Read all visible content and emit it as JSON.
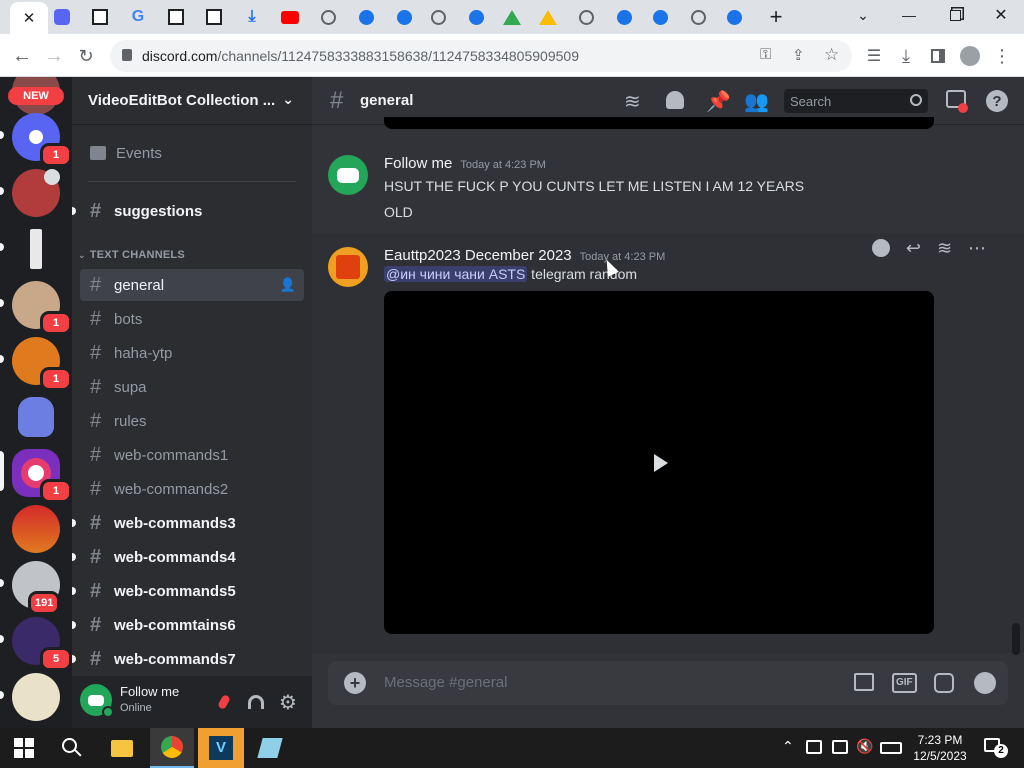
{
  "browser": {
    "url_host": "discord.com",
    "url_path": "/channels/1124758333883158638/1124758334805909509",
    "tab_icons": [
      "discord-icon",
      "wiki-icon",
      "google-icon",
      "wiki-icon",
      "wiki-icon",
      "download-icon",
      "youtube-icon",
      "globe-icon",
      "edge-icon",
      "edge-icon",
      "globe-icon",
      "edge-icon",
      "drive-icon",
      "drive-icon",
      "globe-icon",
      "edge-icon",
      "edge-icon",
      "globe-icon",
      "edge-icon"
    ],
    "new_tab": "+"
  },
  "guilds": {
    "new_label": "NEW",
    "badges": [
      "1",
      "1",
      "1",
      "1",
      "191",
      "5"
    ]
  },
  "server": {
    "name": "VideoEditBot Collection ...",
    "events_label": "Events",
    "top_channel": "suggestions",
    "category": "TEXT CHANNELS",
    "channels": [
      {
        "name": "general",
        "state": "selected"
      },
      {
        "name": "bots",
        "state": "normal"
      },
      {
        "name": "haha-ytp",
        "state": "normal"
      },
      {
        "name": "supa",
        "state": "normal"
      },
      {
        "name": "rules",
        "state": "normal"
      },
      {
        "name": "web-commands1",
        "state": "normal"
      },
      {
        "name": "web-commands2",
        "state": "normal"
      },
      {
        "name": "web-commands3",
        "state": "unread"
      },
      {
        "name": "web-commands4",
        "state": "unread"
      },
      {
        "name": "web-commands5",
        "state": "unread"
      },
      {
        "name": "web-commtains6",
        "state": "unread"
      },
      {
        "name": "web-commands7",
        "state": "unread"
      }
    ]
  },
  "user": {
    "name": "Follow me",
    "status": "Online"
  },
  "channel": {
    "name": "general",
    "search_placeholder": "Search",
    "composer_placeholder": "Message #general"
  },
  "messages": [
    {
      "author": "Follow me",
      "time": "Today at 4:23 PM",
      "lines": [
        "HSUT THE FUCK P YOU CUNTS  LET ME LISTEN I AM 12 YEARS",
        "OLD"
      ]
    },
    {
      "author": "Eauttp2023 December 2023",
      "time": "Today at 4:23 PM",
      "mention": "@ин чини чани ASTS",
      "text": " telegram random"
    }
  ],
  "taskbar": {
    "time": "7:23 PM",
    "date": "12/5/2023",
    "notif_count": "2"
  },
  "colors": {
    "discord_blurple": "#5865f2",
    "online_green": "#23a55a",
    "unread_red": "#f23f43"
  }
}
